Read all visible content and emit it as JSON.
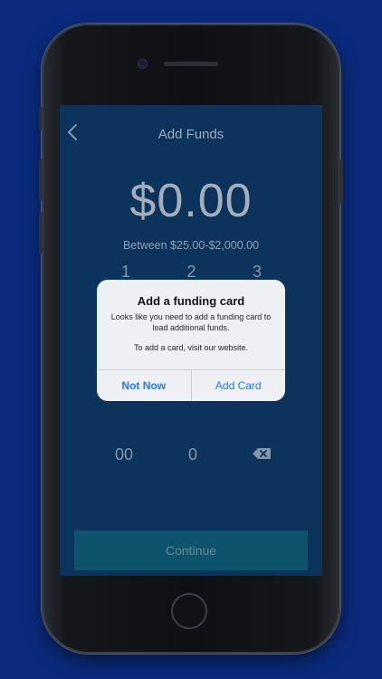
{
  "nav": {
    "title": "Add Funds",
    "back_icon": "chevron-left-icon"
  },
  "amount": {
    "value": "$0.00",
    "range": "Between $25.00-$2,000.00"
  },
  "keypad": {
    "row1": [
      "1",
      "2",
      "3"
    ],
    "bottom": {
      "double_zero": "00",
      "zero": "0",
      "backspace_icon": "backspace-icon"
    }
  },
  "alert": {
    "title": "Add a funding card",
    "message": "Looks like you need to add a funding card to load additional funds.",
    "message2": "To add a card, visit our website.",
    "cancel_label": "Not Now",
    "confirm_label": "Add Card"
  },
  "continue": {
    "label": "Continue"
  },
  "colors": {
    "background": "#0a2b7d",
    "screen": "#0d3e6d",
    "button": "#0f6a83",
    "alert_action": "#1f7cf2"
  }
}
